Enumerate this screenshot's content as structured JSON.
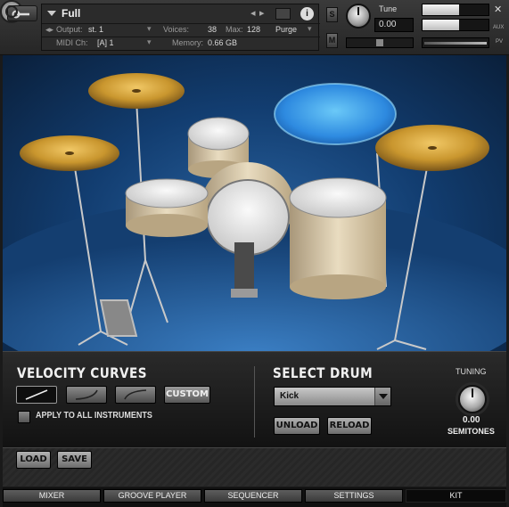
{
  "header": {
    "instrument_name": "Full",
    "output_label": "Output:",
    "output_value": "st. 1",
    "voices_label": "Voices:",
    "voices_value": "38",
    "max_label": "Max:",
    "max_value": "128",
    "purge_label": "Purge",
    "midi_label": "MIDI Ch:",
    "midi_value": "[A]  1",
    "memory_label": "Memory:",
    "memory_value": "0.66 GB",
    "solo_label": "S",
    "mute_label": "M",
    "tune_label": "Tune",
    "tune_value": "0.00",
    "aux_label": "AUX",
    "pv_label": "PV",
    "close_glyph": "✕",
    "info_glyph": "i",
    "camera_glyph": "📷"
  },
  "velocity": {
    "title": "VELOCITY CURVES",
    "custom_label": "CUSTOM",
    "apply_label": "APPLY TO ALL INSTRUMENTS",
    "apply_checked": false,
    "selected_curve": "linear"
  },
  "drum": {
    "title": "SELECT DRUM",
    "selected": "Kick",
    "unload_label": "UNLOAD",
    "reload_label": "RELOAD"
  },
  "tuning": {
    "label": "TUNING",
    "value": "0.00",
    "unit_label": "SEMITONES"
  },
  "footer": {
    "load_label": "LOAD",
    "save_label": "SAVE"
  },
  "tabs": [
    {
      "label": "MIXER",
      "active": false
    },
    {
      "label": "GROOVE PLAYER",
      "active": false
    },
    {
      "label": "SEQUENCER",
      "active": false
    },
    {
      "label": "SETTINGS",
      "active": false
    },
    {
      "label": "KIT",
      "active": true
    }
  ],
  "colors": {
    "backdrop": "#1e5a9a",
    "highlight": "#3aa8ff",
    "cymbal": "#c9962e",
    "drum_shell": "#d8c9a6"
  }
}
